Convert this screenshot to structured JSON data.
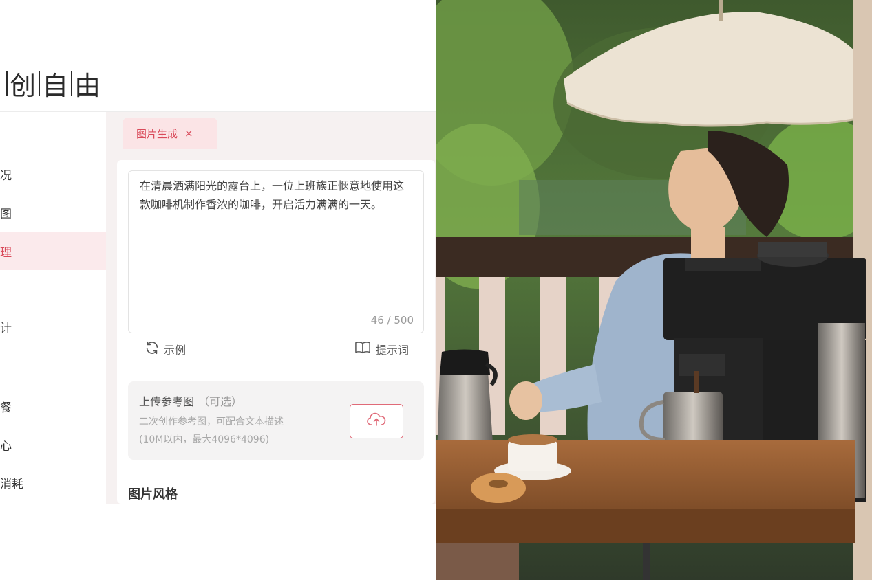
{
  "brand": {
    "chars": [
      "创",
      "自",
      "由"
    ]
  },
  "sidebar": {
    "items": [
      {
        "label": "况"
      },
      {
        "label": "图"
      },
      {
        "label": "理",
        "active": true
      },
      {
        "label": ""
      },
      {
        "label": "计"
      },
      {
        "label": ""
      },
      {
        "label": "餐"
      },
      {
        "label": "心"
      },
      {
        "label": "消耗"
      }
    ]
  },
  "tab": {
    "label": "图片生成",
    "close": "×"
  },
  "prompt": {
    "text": "在清晨洒满阳光的露台上，一位上班族正惬意地使用这款咖啡机制作香浓的咖啡，开启活力满满的一天。",
    "counter": "46 / 500"
  },
  "actions": {
    "example": "示例",
    "prompt_tips": "提示词"
  },
  "upload": {
    "title": "上传参考图",
    "optional": "（可选）",
    "desc_line1": "二次创作参考图，可配合文本描述",
    "desc_line2": "(10M以内，最大4096*4096)"
  },
  "style_section": {
    "title": "图片风格"
  },
  "colors": {
    "accent": "#d94a5a",
    "tab_bg": "#fbe4e6",
    "content_bg": "#f6f1f1"
  },
  "icons": {
    "example": "refresh-icon",
    "prompt_tips": "book-icon",
    "upload": "cloud-upload-icon"
  }
}
